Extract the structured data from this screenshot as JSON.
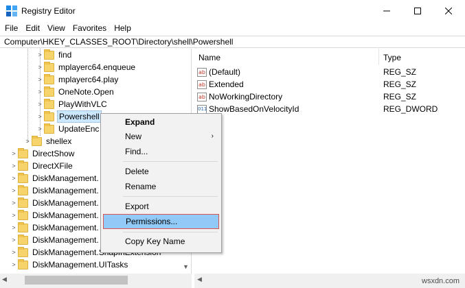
{
  "window": {
    "title": "Registry Editor",
    "minimize_glyph": "—",
    "maximize_glyph": "☐",
    "close_glyph": "✕"
  },
  "menu": [
    "File",
    "Edit",
    "View",
    "Favorites",
    "Help"
  ],
  "address": "Computer\\HKEY_CLASSES_ROOT\\Directory\\shell\\Powershell",
  "tree": {
    "items": [
      {
        "label": "find"
      },
      {
        "label": "mplayerc64.enqueue"
      },
      {
        "label": "mplayerc64.play"
      },
      {
        "label": "OneNote.Open"
      },
      {
        "label": "PlayWithVLC"
      },
      {
        "label": "Powershell"
      },
      {
        "label": "UpdateEnc"
      },
      {
        "label": "shellex"
      },
      {
        "label": "DirectShow"
      },
      {
        "label": "DirectXFile"
      },
      {
        "label": "DiskManagement."
      },
      {
        "label": "DiskManagement."
      },
      {
        "label": "DiskManagement."
      },
      {
        "label": "DiskManagement."
      },
      {
        "label": "DiskManagement."
      },
      {
        "label": "DiskManagement."
      },
      {
        "label": "DiskManagement.SnapInExtension"
      },
      {
        "label": "DiskManagement.UITasks"
      }
    ]
  },
  "list": {
    "headers": {
      "name": "Name",
      "type": "Type"
    },
    "rows": [
      {
        "name": "(Default)",
        "type": "REG_SZ",
        "icon": "ab"
      },
      {
        "name": "Extended",
        "type": "REG_SZ",
        "icon": "ab"
      },
      {
        "name": "NoWorkingDirectory",
        "type": "REG_SZ",
        "icon": "ab"
      },
      {
        "name": "ShowBasedOnVelocityId",
        "type": "REG_DWORD",
        "icon": "011"
      }
    ]
  },
  "context_menu": {
    "expand": "Expand",
    "new": "New",
    "find": "Find...",
    "delete": "Delete",
    "rename": "Rename",
    "export": "Export",
    "permissions": "Permissions...",
    "copy_key_name": "Copy Key Name"
  },
  "watermark": "wsxdn.com"
}
